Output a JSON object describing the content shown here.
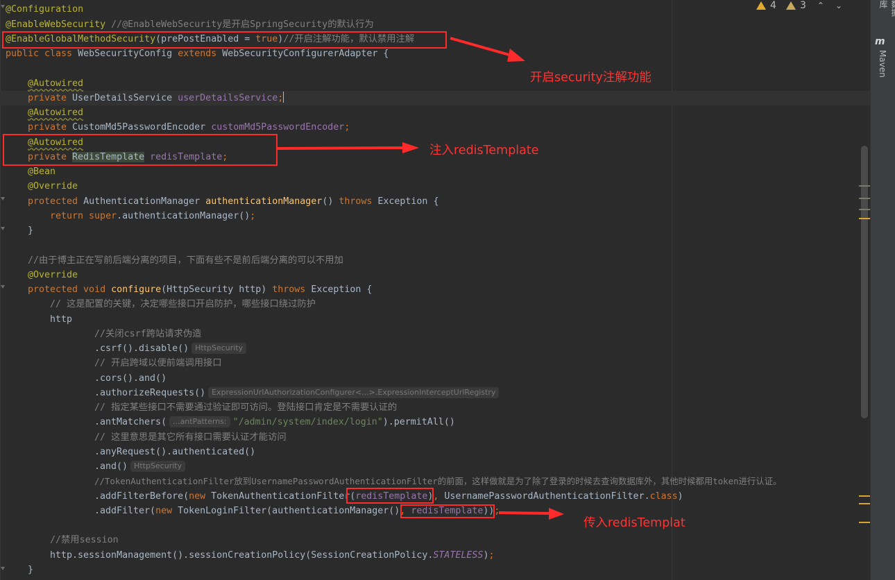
{
  "inspections": {
    "warnings": "4",
    "weak_warnings": "3"
  },
  "tool_window": {
    "label": "Maven",
    "top_label": "数据库"
  },
  "code": {
    "l1": "@Configuration",
    "l2a": "@EnableWebSecurity",
    "l2b": " //@EnableWebSecurity是开启SpringSecurity的默认行为",
    "l3a": "@EnableGlobalMethodSecurity",
    "l3b": "(prePostEnabled = ",
    "l3c": "true",
    "l3d": ")",
    "l3e": "//开启注解功能，默认禁用注解",
    "l4a": "public class ",
    "l4b": "WebSecurityConfig ",
    "l4c": "extends ",
    "l4d": "WebSecurityConfigurerAdapter {",
    "l6": "@Autowired",
    "l7a": "private ",
    "l7b": "UserDetailsService ",
    "l7c": "userDetailsService",
    "l7d": ";",
    "l8": "@Autowired",
    "l9a": "private ",
    "l9b": "CustomMd5PasswordEncoder ",
    "l9c": "customMd5PasswordEncoder",
    "l9d": ";",
    "l10": "@Autowired",
    "l11a": "private ",
    "l11b": "RedisTemplate",
    "l11c": " ",
    "l11d": "redisTemplate",
    "l11e": ";",
    "l12": "@Bean",
    "l13": "@Override",
    "l14a": "protected ",
    "l14b": "AuthenticationManager ",
    "l14c": "authenticationManager",
    "l14d": "() ",
    "l14e": "throws ",
    "l14f": "Exception {",
    "l15a": "return ",
    "l15b": "super",
    "l15c": ".authenticationManager()",
    "l15d": ";",
    "l16": "}",
    "l18": "//由于博主正在写前后端分离的项目，下面有些不是前后端分离的可以不用加",
    "l19": "@Override",
    "l20a": "protected void ",
    "l20b": "configure",
    "l20c": "(HttpSecurity http) ",
    "l20d": "throws ",
    "l20e": "Exception {",
    "l21": "// 这是配置的关键，决定哪些接口开启防护，哪些接口绕过防护",
    "l22": "http",
    "l23": "//关闭csrf跨站请求伪造",
    "l24a": ".csrf().disable()",
    "l24h": "HttpSecurity",
    "l25": "// 开启跨域以便前端调用接口",
    "l26": ".cors().and()",
    "l27a": ".authorizeRequests()",
    "l27h": "ExpressionUrlAuthorizationConfigurer<...>.ExpressionInterceptUrlRegistry",
    "l28": "// 指定某些接口不需要通过验证即可访问。登陆接口肯定是不需要认证的",
    "l29a": ".antMatchers(",
    "l29h": "...antPatterns:",
    "l29b": "\"/admin/system/index/login\"",
    "l29c": ").permitAll()",
    "l30": "// 这里意思是其它所有接口需要认证才能访问",
    "l31": ".anyRequest().authenticated()",
    "l32a": ".and()",
    "l32h": "HttpSecurity",
    "l33": "//TokenAuthenticationFilter放到UsernamePasswordAuthenticationFilter的前面，这样做就是为了除了登录的时候去查询数据库外，其他时候都用token进行认证。",
    "l34a": ".addFilterBefore(",
    "l34b": "new ",
    "l34c": "TokenAuthenticationFilter(",
    "l34d": "redisTemplate",
    "l34e": ")",
    "l34f": ", ",
    "l34g": "UsernamePasswordAuthenticationFilter.",
    "l34h": "class",
    "l34i": ")",
    "l35a": ".addFilter(",
    "l35b": "new ",
    "l35c": "TokenLoginFilter(authenticationManager()",
    "l35d": ", ",
    "l35e": "redisTemplate",
    "l35f": "))",
    "l35g": ";",
    "l37": "//禁用session",
    "l38a": "http.sessionManagement().sessionCreationPolicy(SessionCreationPolicy.",
    "l38b": "STATELESS",
    "l38c": ")",
    "l38d": ";",
    "l39": "}"
  },
  "annotations": {
    "callout1": "开启security注解功能",
    "callout2": "注入redisTemplate",
    "callout3": "传入redisTemplat"
  },
  "colors": {
    "background": "#2b2b2b",
    "keyword": "#cc7832",
    "annotation": "#bbb529",
    "field": "#9876aa",
    "method": "#ffc66d",
    "string": "#6a8759",
    "comment": "#808080",
    "markup_red": "#ff2b2b"
  }
}
